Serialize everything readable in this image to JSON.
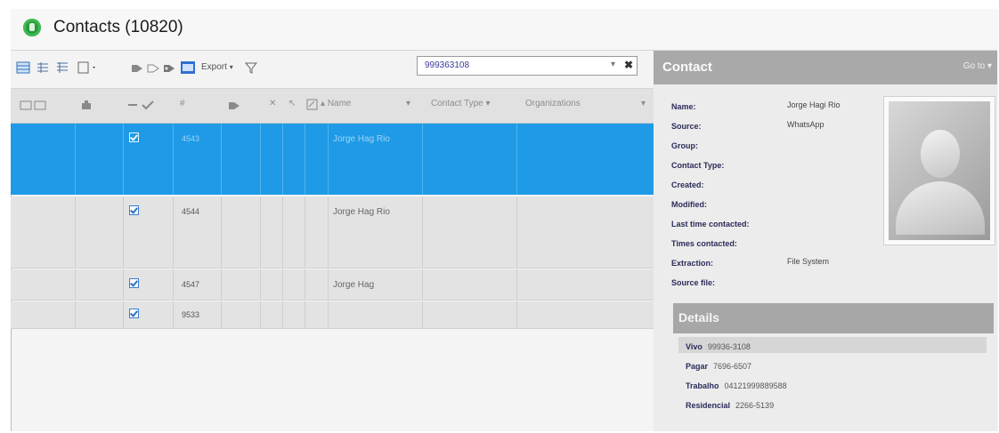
{
  "window": {
    "title": "Contacts (10820)"
  },
  "toolbar": {
    "export_label": "Export",
    "search_value": "999363108"
  },
  "grid": {
    "columns": {
      "id": "#",
      "name": "Name",
      "contact_type": "Contact Type",
      "organizations": "Organizations"
    },
    "rows": [
      {
        "id": "4543",
        "name": "Jorge Hag Rio",
        "selected": true
      },
      {
        "id": "4544",
        "name": "Jorge Hag Rio",
        "selected": false
      },
      {
        "id": "4547",
        "name": "Jorge Hag",
        "selected": false
      },
      {
        "id": "9533",
        "name": "",
        "selected": false
      }
    ]
  },
  "contact_panel": {
    "title": "Contact",
    "goto_label": "Go to",
    "fields": [
      {
        "label": "Name:",
        "value": "Jorge Hagi Rio"
      },
      {
        "label": "Source:",
        "value": "WhatsApp"
      },
      {
        "label": "Group:",
        "value": ""
      },
      {
        "label": "Contact Type:",
        "value": ""
      },
      {
        "label": "Created:",
        "value": ""
      },
      {
        "label": "Modified:",
        "value": ""
      },
      {
        "label": "Last time contacted:",
        "value": ""
      },
      {
        "label": "Times contacted:",
        "value": ""
      },
      {
        "label": "Extraction:",
        "value": "File System"
      },
      {
        "label": "Source file:",
        "value": ""
      }
    ],
    "details_title": "Details",
    "details": [
      {
        "label": "Vivo",
        "value": "99936-3108"
      },
      {
        "label": "Pagar",
        "value": "7696-6507"
      },
      {
        "label": "Trabalho",
        "value": "04121999889588"
      },
      {
        "label": "Residencial",
        "value": "2266-5139"
      }
    ]
  },
  "colors": {
    "selection": "#1f9ae6",
    "app_icon": "#2a9a3e",
    "panel_header": "#a9a9a9"
  }
}
